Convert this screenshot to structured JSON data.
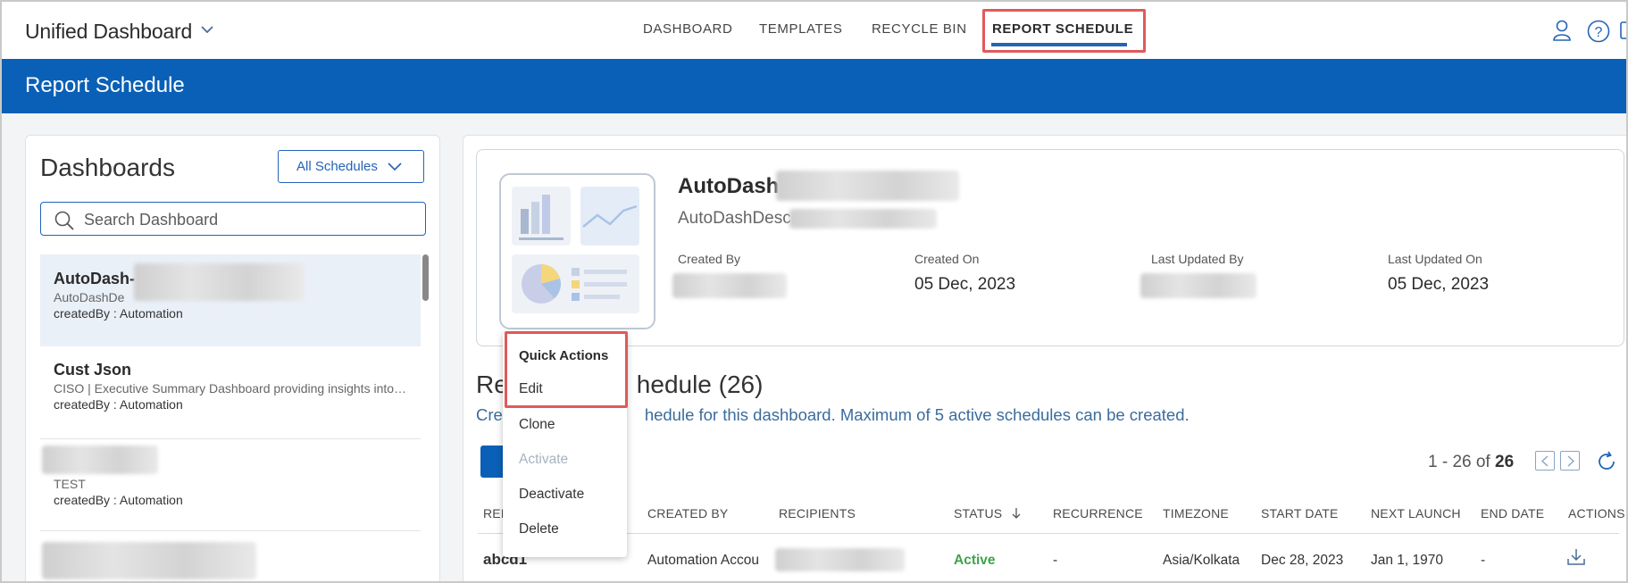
{
  "app": {
    "title": "Unified Dashboard"
  },
  "nav": {
    "items": [
      "DASHBOARD",
      "TEMPLATES",
      "RECYCLE BIN",
      "REPORT SCHEDULE"
    ],
    "active": "REPORT SCHEDULE"
  },
  "banner": {
    "title": "Report Schedule"
  },
  "left_panel": {
    "title": "Dashboards",
    "filter_label": "All Schedules",
    "search_placeholder": "Search Dashboard",
    "items": [
      {
        "name": "AutoDash-",
        "desc": "AutoDashDe",
        "created_by": "createdBy : Automation",
        "selected": true
      },
      {
        "name": "Cust Json",
        "desc": "CISO | Executive Summary Dashboard providing insights into risk and compliance",
        "created_by": "createdBy : Automation",
        "selected": false
      },
      {
        "name": "",
        "desc": "TEST",
        "created_by": "createdBy : Automation",
        "selected": false
      },
      {
        "name": "",
        "desc": "",
        "created_by": "",
        "selected": false
      }
    ]
  },
  "dashboard_card": {
    "title": "AutoDash-",
    "desc": "AutoDashDesc-",
    "created_by_label": "Created By",
    "created_on_label": "Created On",
    "created_on": "05 Dec, 2023",
    "last_updated_by_label": "Last Updated By",
    "last_updated_on_label": "Last Updated On",
    "last_updated_on": "05 Dec, 2023"
  },
  "schedule": {
    "title_left": "Re",
    "title_right": "hedule (26)",
    "subtitle_left": "Cre",
    "subtitle_right": "hedule for this dashboard. Maximum of 5 active schedules can be created.",
    "pager": {
      "range": "1 - 26 of",
      "total": "26"
    },
    "columns": [
      "REP",
      "CREATED BY",
      "RECIPIENTS",
      "STATUS",
      "RECURRENCE",
      "TIMEZONE",
      "START DATE",
      "NEXT LAUNCH",
      "END DATE",
      "ACTIONS"
    ],
    "rows": [
      {
        "name": "abcd1",
        "created_by": "Automation Accou",
        "recipients": "",
        "status": "Active",
        "recurrence": "-",
        "timezone": "Asia/Kolkata",
        "start_date": "Dec 28, 2023",
        "next_launch": "Jan 1, 1970",
        "end_date": "-"
      }
    ]
  },
  "quick_actions": {
    "header": "Quick Actions",
    "items": [
      {
        "label": "Edit",
        "enabled": true
      },
      {
        "label": "Clone",
        "enabled": true
      },
      {
        "label": "Activate",
        "enabled": false
      },
      {
        "label": "Deactivate",
        "enabled": true
      },
      {
        "label": "Delete",
        "enabled": true
      }
    ]
  },
  "colors": {
    "brand_blue": "#0a60b6",
    "highlight_red": "#e05a5a",
    "active_green": "#3ea34b",
    "disabled": "#a8b3c0"
  },
  "icons": [
    "chevron-down-icon",
    "user-icon",
    "help-icon",
    "search-icon",
    "refresh-icon",
    "download-icon",
    "sort-down-icon",
    "chevron-left-icon",
    "chevron-right-icon"
  ]
}
